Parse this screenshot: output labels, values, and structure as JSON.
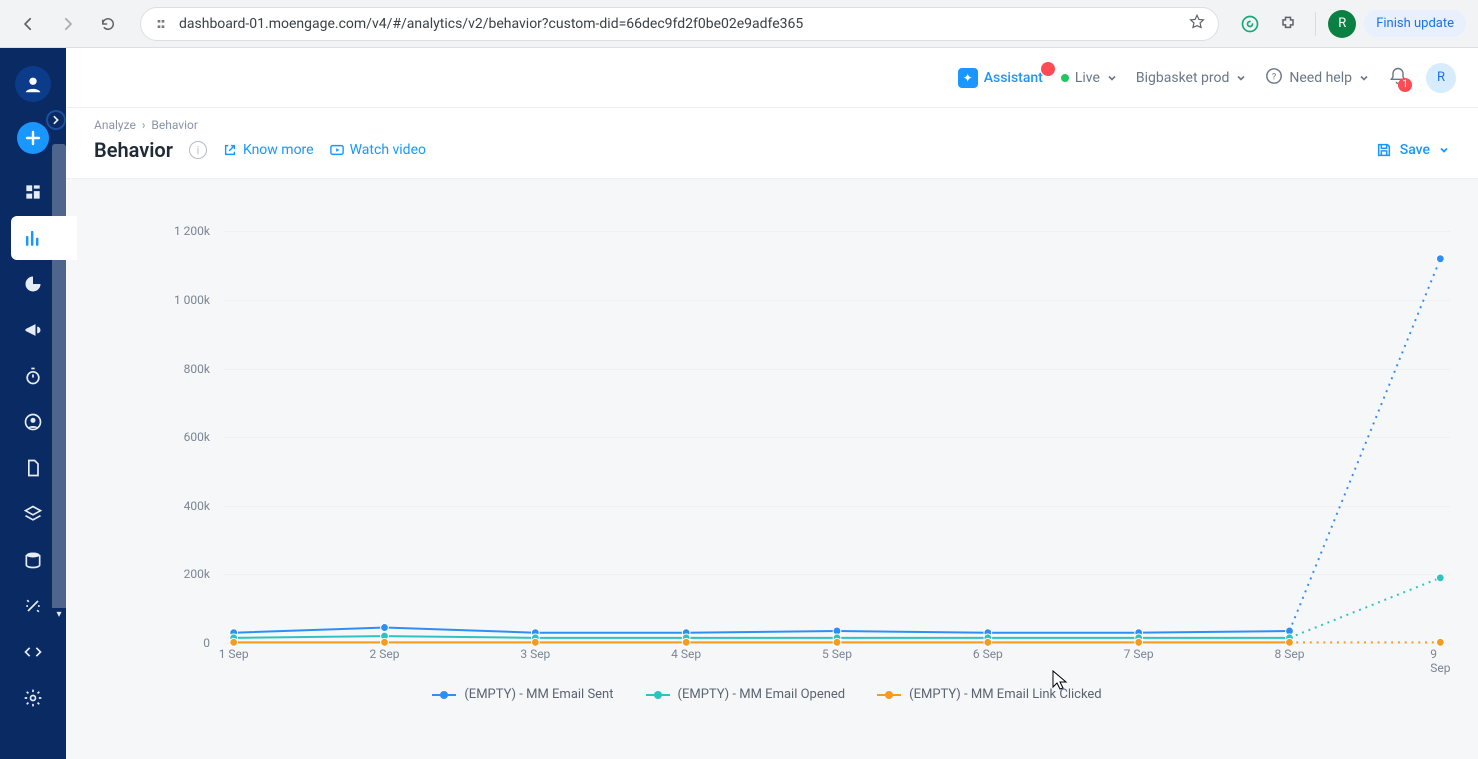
{
  "browser": {
    "url": "dashboard-01.moengage.com/v4/#/analytics/v2/behavior?custom-did=66dec9fd2f0be02e9adfe365",
    "finish_update_label": "Finish update",
    "avatar": "R"
  },
  "topbar": {
    "assistant_label": "Assistant",
    "live_label": "Live",
    "workspace_label": "Bigbasket prod",
    "help_label": "Need help",
    "notifications_badge": "1",
    "avatar": "R"
  },
  "breadcrumb": {
    "root": "Analyze",
    "page": "Behavior"
  },
  "title": {
    "text": "Behavior",
    "know_more": "Know more",
    "watch_video": "Watch video",
    "save": "Save"
  },
  "sidebar": {
    "items": [
      {
        "name": "dashboard-icon"
      },
      {
        "name": "bar-chart-icon",
        "active": true
      },
      {
        "name": "pie-chart-icon"
      },
      {
        "name": "megaphone-icon"
      },
      {
        "name": "timer-icon"
      },
      {
        "name": "user-circle-icon"
      },
      {
        "name": "file-icon"
      },
      {
        "name": "layers-icon"
      },
      {
        "name": "database-icon"
      },
      {
        "name": "wand-icon"
      },
      {
        "name": "code-icon"
      },
      {
        "name": "gear-icon"
      }
    ]
  },
  "chart_data": {
    "type": "line",
    "xlabel": "",
    "ylabel": "",
    "ylim": [
      0,
      1300000
    ],
    "y_ticks": [
      0,
      200000,
      400000,
      600000,
      800000,
      1000000,
      1200000
    ],
    "y_tick_labels": [
      "0",
      "200k",
      "400k",
      "600k",
      "800k",
      "1 000k",
      "1 200k"
    ],
    "categories": [
      "1 Sep",
      "2 Sep",
      "3 Sep",
      "4 Sep",
      "5 Sep",
      "6 Sep",
      "7 Sep",
      "8 Sep",
      "9 Sep"
    ],
    "series": [
      {
        "name": "(EMPTY) - MM Email Sent",
        "color": "#2f8ef6",
        "values": [
          30000,
          45000,
          30000,
          30000,
          35000,
          30000,
          30000,
          35000,
          1120000
        ],
        "dotted_from_index": 7
      },
      {
        "name": "(EMPTY) - MM Email Opened",
        "color": "#2cc4c0",
        "values": [
          15000,
          20000,
          15000,
          15000,
          15000,
          15000,
          15000,
          15000,
          190000
        ],
        "dotted_from_index": 7
      },
      {
        "name": "(EMPTY) - MM Email Link Clicked",
        "color": "#f59b1f",
        "values": [
          2000,
          2000,
          2000,
          2000,
          2000,
          2000,
          2000,
          2000,
          2000
        ],
        "dotted_from_index": 7
      }
    ]
  }
}
